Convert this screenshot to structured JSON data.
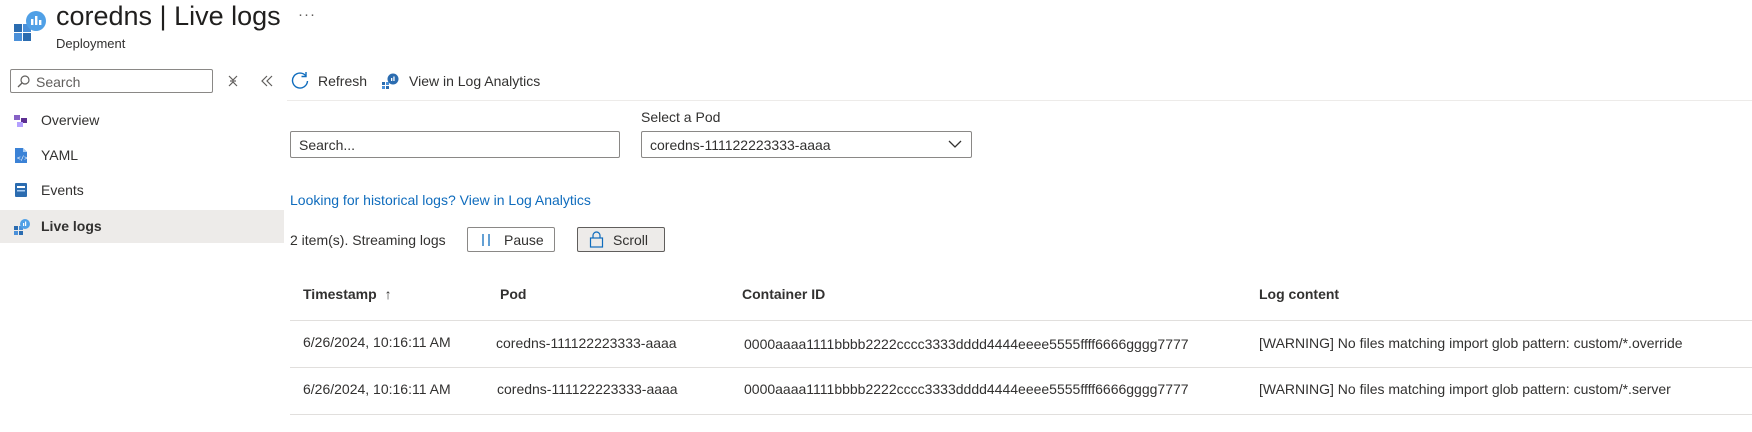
{
  "header": {
    "title": "coredns | Live logs",
    "subtitle": "Deployment",
    "more_label": "···"
  },
  "sidebar": {
    "search_placeholder": "Search",
    "items": [
      {
        "label": "Overview",
        "icon": "overview-icon"
      },
      {
        "label": "YAML",
        "icon": "yaml-file-icon"
      },
      {
        "label": "Events",
        "icon": "events-icon"
      },
      {
        "label": "Live logs",
        "icon": "live-logs-icon",
        "active": true
      }
    ]
  },
  "toolbar": {
    "refresh_label": "Refresh",
    "log_analytics_label": "View in Log Analytics"
  },
  "filters": {
    "search_placeholder": "Search...",
    "pod_label": "Select a Pod",
    "pod_value": "coredns-111122223333-aaaa"
  },
  "historical_link": "Looking for historical logs? View in Log Analytics",
  "status_text": "2 item(s). Streaming logs",
  "controls": {
    "pause_label": "Pause",
    "scroll_label": "Scroll"
  },
  "table": {
    "headers": [
      "Timestamp",
      "Pod",
      "Container ID",
      "Log content"
    ],
    "sort_indicator": "↑",
    "rows": [
      [
        "6/26/2024, 10:16:11 AM",
        "coredns-111122223333-aaaa",
        "0000aaaa1111bbbb2222cccc3333dddd4444eeee5555ffff6666gggg7777",
        "[WARNING] No files matching import glob pattern: custom/*.override"
      ],
      [
        "6/26/2024, 10:16:11 AM",
        "coredns-111122223333-aaaa",
        "0000aaaa1111bbbb2222cccc3333dddd4444eeee5555ffff6666gggg7777",
        "[WARNING] No files matching import glob pattern: custom/*.server"
      ]
    ]
  },
  "colors": {
    "accent": "#0f6cbd",
    "selected_bg": "#edebe9",
    "border": "#8a8886"
  }
}
